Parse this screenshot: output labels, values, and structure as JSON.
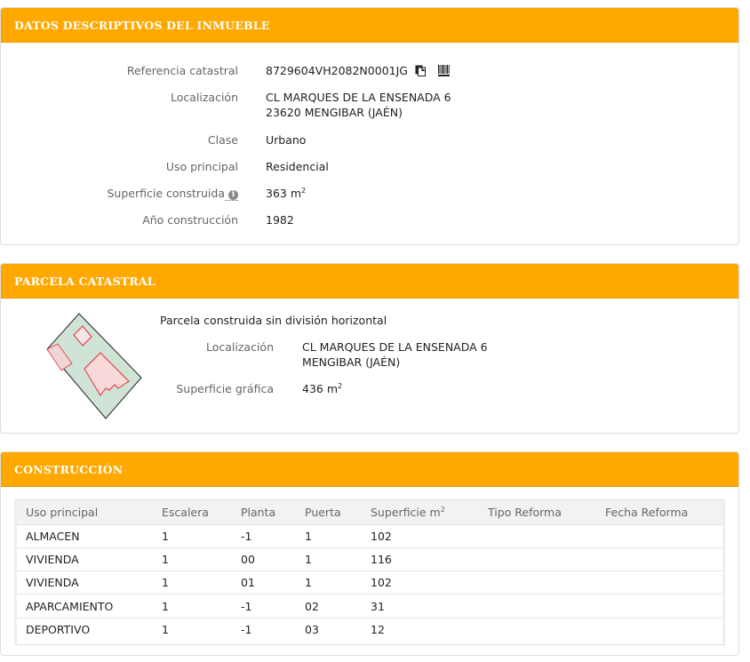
{
  "inmueble": {
    "title": "DATOS DESCRIPTIVOS DEL INMUEBLE",
    "fields": {
      "referencia_label": "Referencia catastral",
      "referencia_value": "8729604VH2082N0001JG",
      "localizacion_label": "Localización",
      "localizacion_line1": "CL MARQUES DE LA ENSENADA 6",
      "localizacion_line2": "23620 MENGIBAR (JAÉN)",
      "clase_label": "Clase",
      "clase_value": "Urbano",
      "uso_label": "Uso principal",
      "uso_value": "Residencial",
      "superficie_label": "Superficie construida",
      "superficie_value": "363 m",
      "superficie_sup": "2",
      "anio_label": "Año construcción",
      "anio_value": "1982"
    },
    "icons": [
      "copy-icon",
      "barcode-icon",
      "info-icon"
    ]
  },
  "parcela": {
    "title": "PARCELA CATASTRAL",
    "subtitle": "Parcela construida sin división horizontal",
    "localizacion_label": "Localización",
    "localizacion_line1": "CL MARQUES DE LA ENSENADA 6",
    "localizacion_line2": "MENGIBAR (JAÉN)",
    "superficie_label": "Superficie gráfica",
    "superficie_value": "436 m",
    "superficie_sup": "2",
    "colors": {
      "parcel_fill": "#cfe3d7",
      "building_fill": "#f7d9d9",
      "building_stroke": "#e0303a"
    }
  },
  "construccion": {
    "title": "CONSTRUCCIÓN",
    "headers": [
      "Uso principal",
      "Escalera",
      "Planta",
      "Puerta",
      "Superficie m",
      "Tipo Reforma",
      "Fecha Reforma"
    ],
    "superficie_sup": "2",
    "rows": [
      [
        "ALMACEN",
        "1",
        "-1",
        "1",
        "102",
        "",
        ""
      ],
      [
        "VIVIENDA",
        "1",
        "00",
        "1",
        "116",
        "",
        ""
      ],
      [
        "VIVIENDA",
        "1",
        "01",
        "1",
        "102",
        "",
        ""
      ],
      [
        "APARCAMIENTO",
        "1",
        "-1",
        "02",
        "31",
        "",
        ""
      ],
      [
        "DEPORTIVO",
        "1",
        "-1",
        "03",
        "12",
        "",
        ""
      ]
    ]
  },
  "colors": {
    "header_bg": "#ffa800",
    "header_text": "#ffffff"
  }
}
